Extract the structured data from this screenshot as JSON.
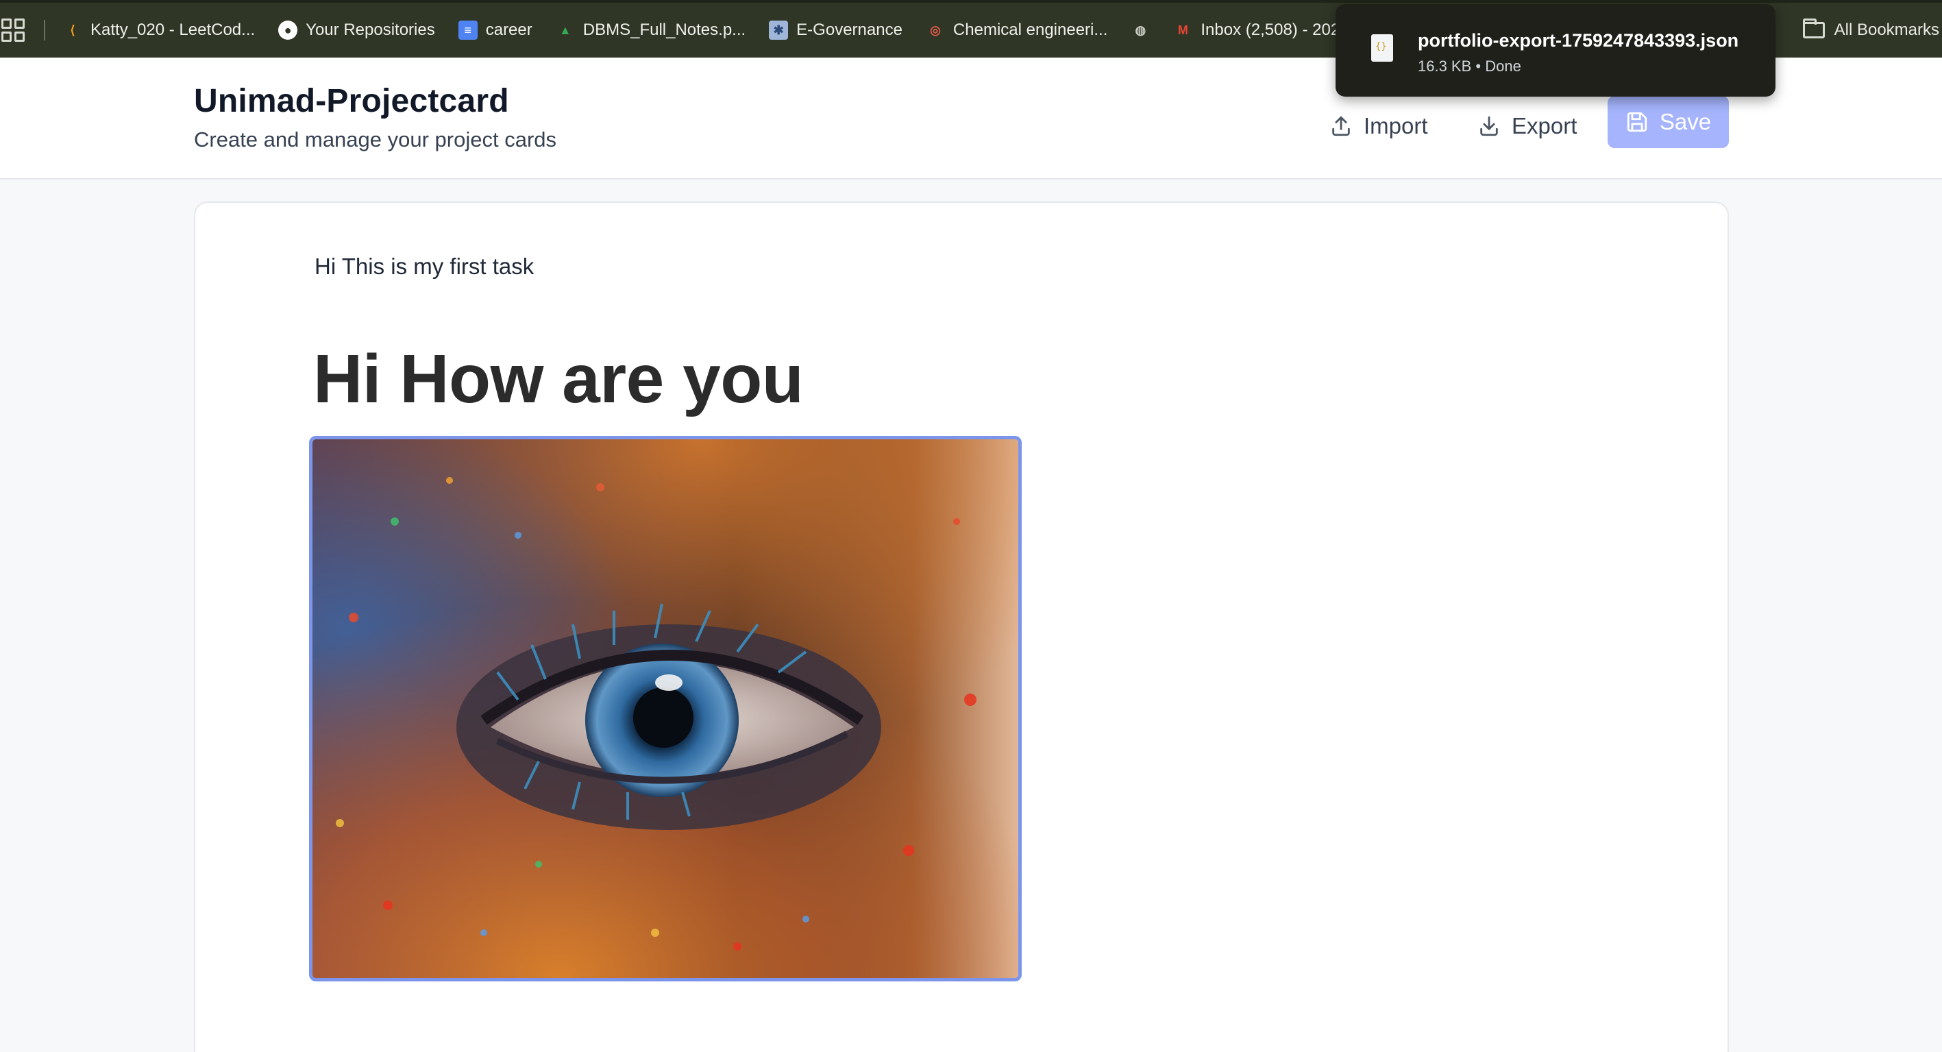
{
  "bookmarks": [
    {
      "label": "Katty_020 - LeetCod...",
      "icon": "leetcode-icon",
      "color": "#f89f1b"
    },
    {
      "label": "Your Repositories",
      "icon": "github-icon",
      "color": "#ffffff"
    },
    {
      "label": "career",
      "icon": "docs-icon",
      "color": "#4f83f1"
    },
    {
      "label": "DBMS_Full_Notes.p...",
      "icon": "drive-icon",
      "color": "#34a853"
    },
    {
      "label": "E-Governance",
      "icon": "egov-icon",
      "color": "#9fb6d9"
    },
    {
      "label": "Chemical engineeri...",
      "icon": "target-icon",
      "color": "#e05a47"
    },
    {
      "label": "",
      "icon": "globe-icon",
      "color": "#c9ccc4"
    },
    {
      "label": "Inbox (2,508) - 202",
      "icon": "gmail-icon",
      "color": "#ea4335"
    }
  ],
  "all_bookmarks_label": "All Bookmarks",
  "header": {
    "title": "Unimad-Projectcard",
    "subtitle": "Create and manage your project cards",
    "import_label": "Import",
    "export_label": "Export",
    "save_label": "Save"
  },
  "card": {
    "task_text": "Hi This is my first task",
    "heading": "Hi How are you"
  },
  "download": {
    "filename": "portfolio-export-1759247843393.json",
    "status": "16.3 KB • Done"
  },
  "colors": {
    "accent": "#a5b4fc",
    "image_border": "#7c95ea",
    "bookmarks_bg": "#2f3626"
  }
}
